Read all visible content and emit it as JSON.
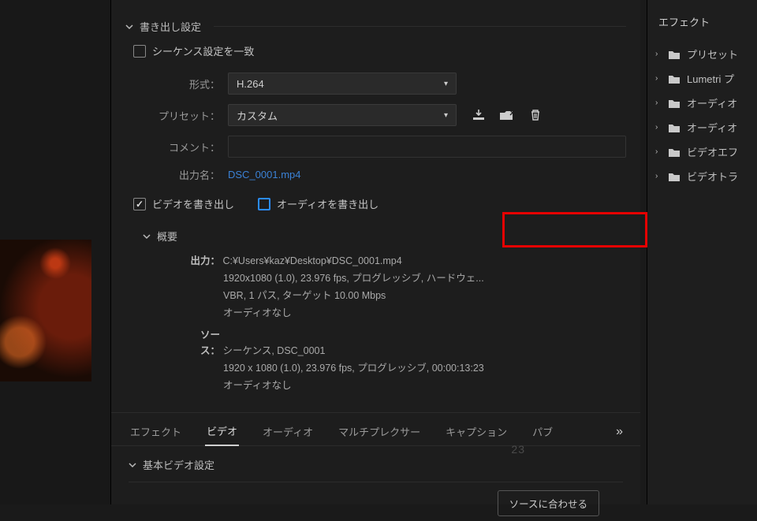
{
  "sidebar": {
    "title": "エフェクト",
    "items": [
      {
        "label": "プリセット"
      },
      {
        "label": "Lumetri プ"
      },
      {
        "label": "オーディオ"
      },
      {
        "label": "オーディオ"
      },
      {
        "label": "ビデオエフ"
      },
      {
        "label": "ビデオトラ"
      }
    ]
  },
  "export": {
    "section_title": "書き出し設定",
    "match_sequence_label": "シーケンス設定を一致",
    "format_label": "形式：",
    "format_value": "H.264",
    "preset_label": "プリセット：",
    "preset_value": "カスタム",
    "comment_label": "コメント：",
    "output_name_label": "出力名：",
    "output_name_value": "DSC_0001.mp4",
    "export_video_label": "ビデオを書き出し",
    "export_audio_label": "オーディオを書き出し",
    "summary_title": "概要",
    "output_label": "出力：",
    "output_path": "C:¥Users¥kaz¥Desktop¥DSC_0001.mp4",
    "output_line2": "1920x1080 (1.0), 23.976 fps, プログレッシブ, ハードウェ...",
    "output_line3": "VBR, 1 パス, ターゲット 10.00 Mbps",
    "output_line4": "オーディオなし",
    "source_label": "ソース：",
    "source_line1": "シーケンス, DSC_0001",
    "source_line2": "1920 x 1080 (1.0), 23.976 fps, プログレッシブ, 00:00:13:23",
    "source_line3": "オーディオなし"
  },
  "tabs": {
    "effects": "エフェクト",
    "video": "ビデオ",
    "audio": "オーディオ",
    "multiplexer": "マルチプレクサー",
    "captions": "キャプション",
    "pub": "パブ"
  },
  "basic": {
    "section_title": "基本ビデオ設定",
    "match_source_button": "ソースに合わせる"
  },
  "ghost_ts": "23"
}
